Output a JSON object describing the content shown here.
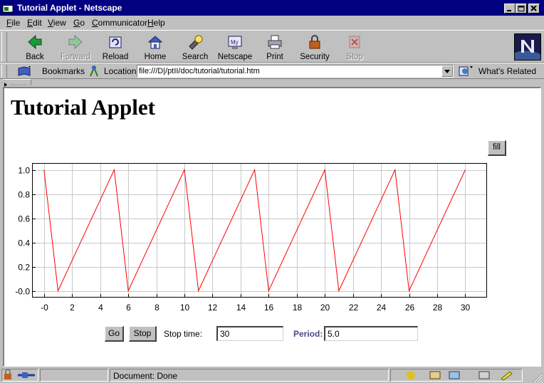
{
  "window": {
    "title": "Tutorial Applet - Netscape"
  },
  "menu": [
    "File",
    "Edit",
    "View",
    "Go",
    "Communicator",
    "Help"
  ],
  "toolbar": {
    "back": "Back",
    "forward": "Forward",
    "reload": "Reload",
    "home": "Home",
    "search": "Search",
    "netscape": "Netscape",
    "print": "Print",
    "security": "Security",
    "stop": "Stop"
  },
  "location": {
    "bookmarks": "Bookmarks",
    "label": "Location:",
    "url": "file:///D|/ptII/doc/tutorial/tutorial.htm",
    "related": "What's Related"
  },
  "page": {
    "title": "Tutorial Applet",
    "fill_button": "fill",
    "go_button": "Go",
    "stop_button": "Stop",
    "stop_time_label": "Stop time:",
    "stop_time_value": "30",
    "period_label": "Period:",
    "period_value": "5.0"
  },
  "status": {
    "text": "Document: Done"
  },
  "colors": {
    "title_bar": "#000080",
    "plot_line": "#ff0000",
    "period_label": "#4b4b87"
  },
  "chart_data": {
    "type": "line",
    "title": "",
    "xlabel": "",
    "ylabel": "",
    "xlim": [
      -0.8,
      31.5
    ],
    "ylim": [
      -0.05,
      1.05
    ],
    "grid": true,
    "x_ticks": [
      "-0",
      "2",
      "4",
      "6",
      "8",
      "10",
      "12",
      "14",
      "16",
      "18",
      "20",
      "22",
      "24",
      "26",
      "28",
      "30"
    ],
    "y_ticks": [
      "-0.0",
      "0.2",
      "0.4",
      "0.6",
      "0.8",
      "1.0"
    ],
    "series": [
      {
        "color": "#ff0000",
        "x": [
          0,
          1,
          5,
          6,
          10,
          11,
          15,
          16,
          20,
          21,
          25,
          26,
          30
        ],
        "y": [
          1.0,
          0.0,
          1.0,
          0.0,
          1.0,
          0.0,
          1.0,
          0.0,
          1.0,
          0.0,
          1.0,
          0.0,
          1.0
        ]
      }
    ]
  }
}
